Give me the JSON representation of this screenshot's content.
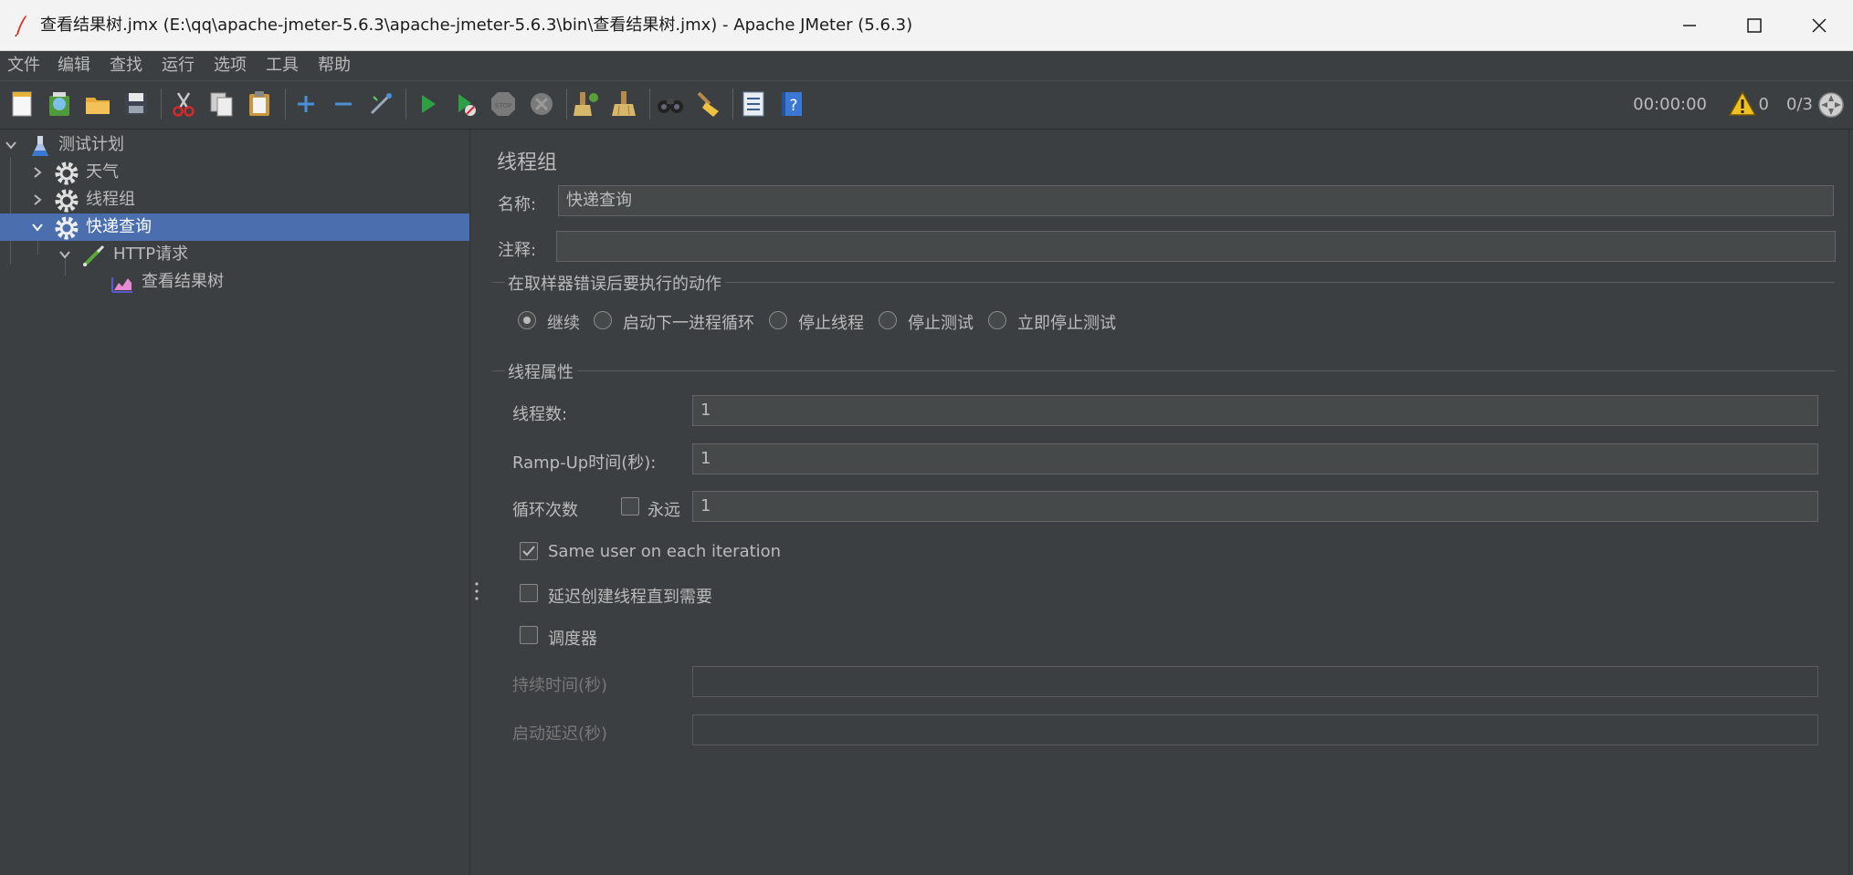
{
  "window": {
    "title": "查看结果树.jmx (E:\\qq\\apache-jmeter-5.6.3\\apache-jmeter-5.6.3\\bin\\查看结果树.jmx) - Apache JMeter (5.6.3)"
  },
  "menu": [
    "文件",
    "编辑",
    "查找",
    "运行",
    "选项",
    "工具",
    "帮助"
  ],
  "toolbar": {
    "timer": "00:00:00",
    "warning_count": "0",
    "threads": "0/3"
  },
  "tree": {
    "items": [
      {
        "label": "测试计划"
      },
      {
        "label": "天气"
      },
      {
        "label": "线程组"
      },
      {
        "label": "快递查询"
      },
      {
        "label": "HTTP请求"
      },
      {
        "label": "查看结果树"
      }
    ]
  },
  "panel": {
    "title": "线程组",
    "name_label": "名称:",
    "name_value": "快递查询",
    "comment_label": "注释:",
    "comment_value": "",
    "error_action": {
      "title": "在取样器错误后要执行的动作",
      "options": [
        "继续",
        "启动下一进程循环",
        "停止线程",
        "停止测试",
        "立即停止测试"
      ],
      "selected": "继续"
    },
    "thread_props": {
      "title": "线程属性",
      "threads_label": "线程数:",
      "threads_value": "1",
      "rampup_label": "Ramp-Up时间(秒):",
      "rampup_value": "1",
      "loop_label": "循环次数",
      "forever_label": "永远",
      "forever_checked": false,
      "loop_value": "1",
      "same_user_label": "Same user on each iteration",
      "same_user_checked": true,
      "delay_label": "延迟创建线程直到需要",
      "delay_checked": false,
      "scheduler_label": "调度器",
      "scheduler_checked": false,
      "duration_label": "持续时间(秒)",
      "duration_value": "",
      "startup_delay_label": "启动延迟(秒)",
      "startup_delay_value": ""
    }
  },
  "colors": {
    "background": "#3c3f41",
    "selection": "#4b6eaf",
    "text": "#bbbbbb"
  }
}
